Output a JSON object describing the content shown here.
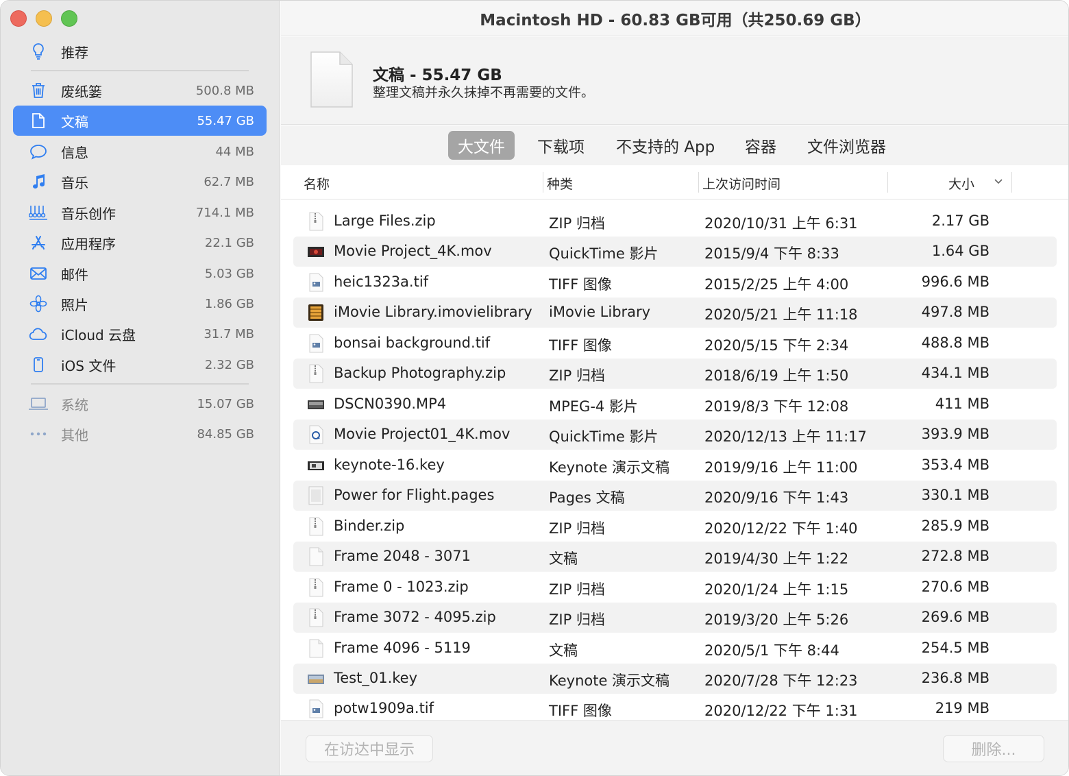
{
  "window": {
    "title": "Macintosh HD - 60.83 GB可用（共250.69 GB）"
  },
  "sidebar": {
    "items": [
      {
        "label": "推荐",
        "size": "",
        "icon": "lightbulb-icon"
      },
      {
        "label": "废纸篓",
        "size": "500.8 MB",
        "icon": "trash-icon"
      },
      {
        "label": "文稿",
        "size": "55.47 GB",
        "icon": "document-icon",
        "selected": true
      },
      {
        "label": "信息",
        "size": "44 MB",
        "icon": "message-bubble-icon"
      },
      {
        "label": "音乐",
        "size": "62.7 MB",
        "icon": "music-note-icon"
      },
      {
        "label": "音乐创作",
        "size": "714.1 MB",
        "icon": "music-creation-icon"
      },
      {
        "label": "应用程序",
        "size": "22.1 GB",
        "icon": "app-store-icon"
      },
      {
        "label": "邮件",
        "size": "5.03 GB",
        "icon": "envelope-icon"
      },
      {
        "label": "照片",
        "size": "1.86 GB",
        "icon": "photos-flower-icon"
      },
      {
        "label": "iCloud 云盘",
        "size": "31.7 MB",
        "icon": "cloud-icon"
      },
      {
        "label": "iOS 文件",
        "size": "2.32 GB",
        "icon": "iphone-icon"
      },
      {
        "label": "系统",
        "size": "15.07 GB",
        "icon": "laptop-icon"
      },
      {
        "label": "其他",
        "size": "84.85 GB",
        "icon": "ellipsis-icon"
      }
    ]
  },
  "header": {
    "title": "文稿 - 55.47 GB",
    "subtitle": "整理文稿并永久抹掉不再需要的文件。"
  },
  "tabs": [
    "大文件",
    "下载项",
    "不支持的 App",
    "容器",
    "文件浏览器"
  ],
  "columns": {
    "name": "名称",
    "kind": "种类",
    "date": "上次访问时间",
    "size": "大小"
  },
  "files": [
    {
      "name": "Large Files.zip",
      "kind": "ZIP 归档",
      "date": "2020/10/31 上午 6:31",
      "size": "2.17 GB",
      "icon": "zip-icon"
    },
    {
      "name": "Movie Project_4K.mov",
      "kind": "QuickTime 影片",
      "date": "2015/9/4 下午 8:33",
      "size": "1.64 GB",
      "icon": "movie-thumbnail-icon"
    },
    {
      "name": "heic1323a.tif",
      "kind": "TIFF 图像",
      "date": "2015/2/25 上午 4:00",
      "size": "996.6 MB",
      "icon": "tiff-image-icon"
    },
    {
      "name": "iMovie Library.imovielibrary",
      "kind": "iMovie Library",
      "date": "2020/5/21 上午 11:18",
      "size": "497.8 MB",
      "icon": "imovie-library-icon"
    },
    {
      "name": "bonsai background.tif",
      "kind": "TIFF 图像",
      "date": "2020/5/15 下午 2:34",
      "size": "488.8 MB",
      "icon": "tiff-image-icon"
    },
    {
      "name": "Backup Photography.zip",
      "kind": "ZIP 归档",
      "date": "2018/6/19 上午 1:50",
      "size": "434.1 MB",
      "icon": "zip-icon"
    },
    {
      "name": "DSCN0390.MP4",
      "kind": "MPEG-4 影片",
      "date": "2019/8/3 下午 12:08",
      "size": "411 MB",
      "icon": "video-thumbnail-icon"
    },
    {
      "name": "Movie Project01_4K.mov",
      "kind": "QuickTime 影片",
      "date": "2020/12/13 上午 11:17",
      "size": "393.9 MB",
      "icon": "quicktime-icon"
    },
    {
      "name": "keynote-16.key",
      "kind": "Keynote 演示文稿",
      "date": "2019/9/16 上午 11:00",
      "size": "353.4 MB",
      "icon": "keynote-icon"
    },
    {
      "name": "Power for Flight.pages",
      "kind": "Pages 文稿",
      "date": "2020/9/16 下午 1:43",
      "size": "330.1 MB",
      "icon": "pages-document-icon"
    },
    {
      "name": "Binder.zip",
      "kind": "ZIP 归档",
      "date": "2020/12/22 下午 1:40",
      "size": "285.9 MB",
      "icon": "zip-icon"
    },
    {
      "name": "Frame 2048 - 3071",
      "kind": "文稿",
      "date": "2019/4/30 上午 1:22",
      "size": "272.8 MB",
      "icon": "blank-document-icon"
    },
    {
      "name": "Frame 0 - 1023.zip",
      "kind": "ZIP 归档",
      "date": "2020/1/24 上午 1:15",
      "size": "270.6 MB",
      "icon": "zip-icon"
    },
    {
      "name": "Frame 3072 - 4095.zip",
      "kind": "ZIP 归档",
      "date": "2019/3/20 上午 5:26",
      "size": "269.6 MB",
      "icon": "zip-icon"
    },
    {
      "name": "Frame 4096 - 5119",
      "kind": "文稿",
      "date": "2020/5/1 下午 8:44",
      "size": "254.5 MB",
      "icon": "blank-document-icon"
    },
    {
      "name": "Test_01.key",
      "kind": "Keynote 演示文稿",
      "date": "2020/7/28 下午 12:23",
      "size": "236.8 MB",
      "icon": "keynote-thumbnail-icon"
    },
    {
      "name": "potw1909a.tif",
      "kind": "TIFF 图像",
      "date": "2020/12/22 下午 1:31",
      "size": "219 MB",
      "icon": "tiff-image-icon"
    }
  ],
  "footer": {
    "finder_button": "在访达中显示",
    "delete_button": "删除..."
  },
  "colors": {
    "accent": "#4d8df6",
    "sidebar_bg": "#e8e8e8",
    "tab_active": "#a5a5a5"
  }
}
